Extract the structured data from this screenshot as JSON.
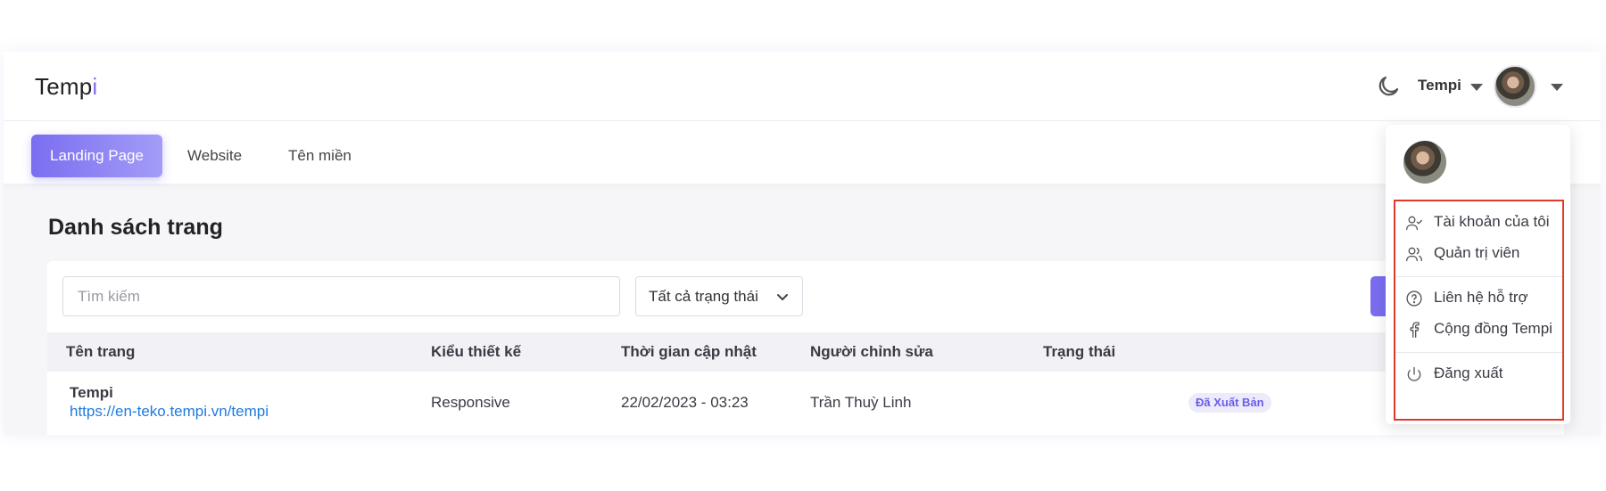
{
  "header": {
    "logo_text": "Temp",
    "logo_accent": "i",
    "user_name": "Tempi"
  },
  "tabs": [
    {
      "label": "Landing Page",
      "active": true
    },
    {
      "label": "Website",
      "active": false
    },
    {
      "label": "Tên miền",
      "active": false
    }
  ],
  "page_title": "Danh sách trang",
  "filters": {
    "search_placeholder": "Tìm kiếm",
    "status_select": "Tất cả trạng thái"
  },
  "table": {
    "columns": [
      "Tên trang",
      "Kiểu thiết kế",
      "Thời gian cập nhật",
      "Người chỉnh sửa",
      "Trạng thái"
    ],
    "rows": [
      {
        "name": "Tempi",
        "url": "https://en-teko.tempi.vn/tempi",
        "design": "Responsive",
        "updated": "22/02/2023 - 03:23",
        "editor": "Trần Thuỳ Linh",
        "status": "Đã Xuất Bản"
      }
    ]
  },
  "user_menu": {
    "items": [
      {
        "label": "Tài khoản của tôi",
        "icon": "user-check-icon"
      },
      {
        "label": "Quản trị viên",
        "icon": "users-icon"
      },
      {
        "label": "Liên hệ hỗ trợ",
        "icon": "help-circle-icon"
      },
      {
        "label": "Cộng đồng Tempi",
        "icon": "facebook-icon"
      },
      {
        "label": "Đăng xuất",
        "icon": "power-icon"
      }
    ]
  },
  "colors": {
    "accent": "#7a6ef0",
    "link": "#1f7ae0",
    "highlight_border": "#e0392b"
  }
}
